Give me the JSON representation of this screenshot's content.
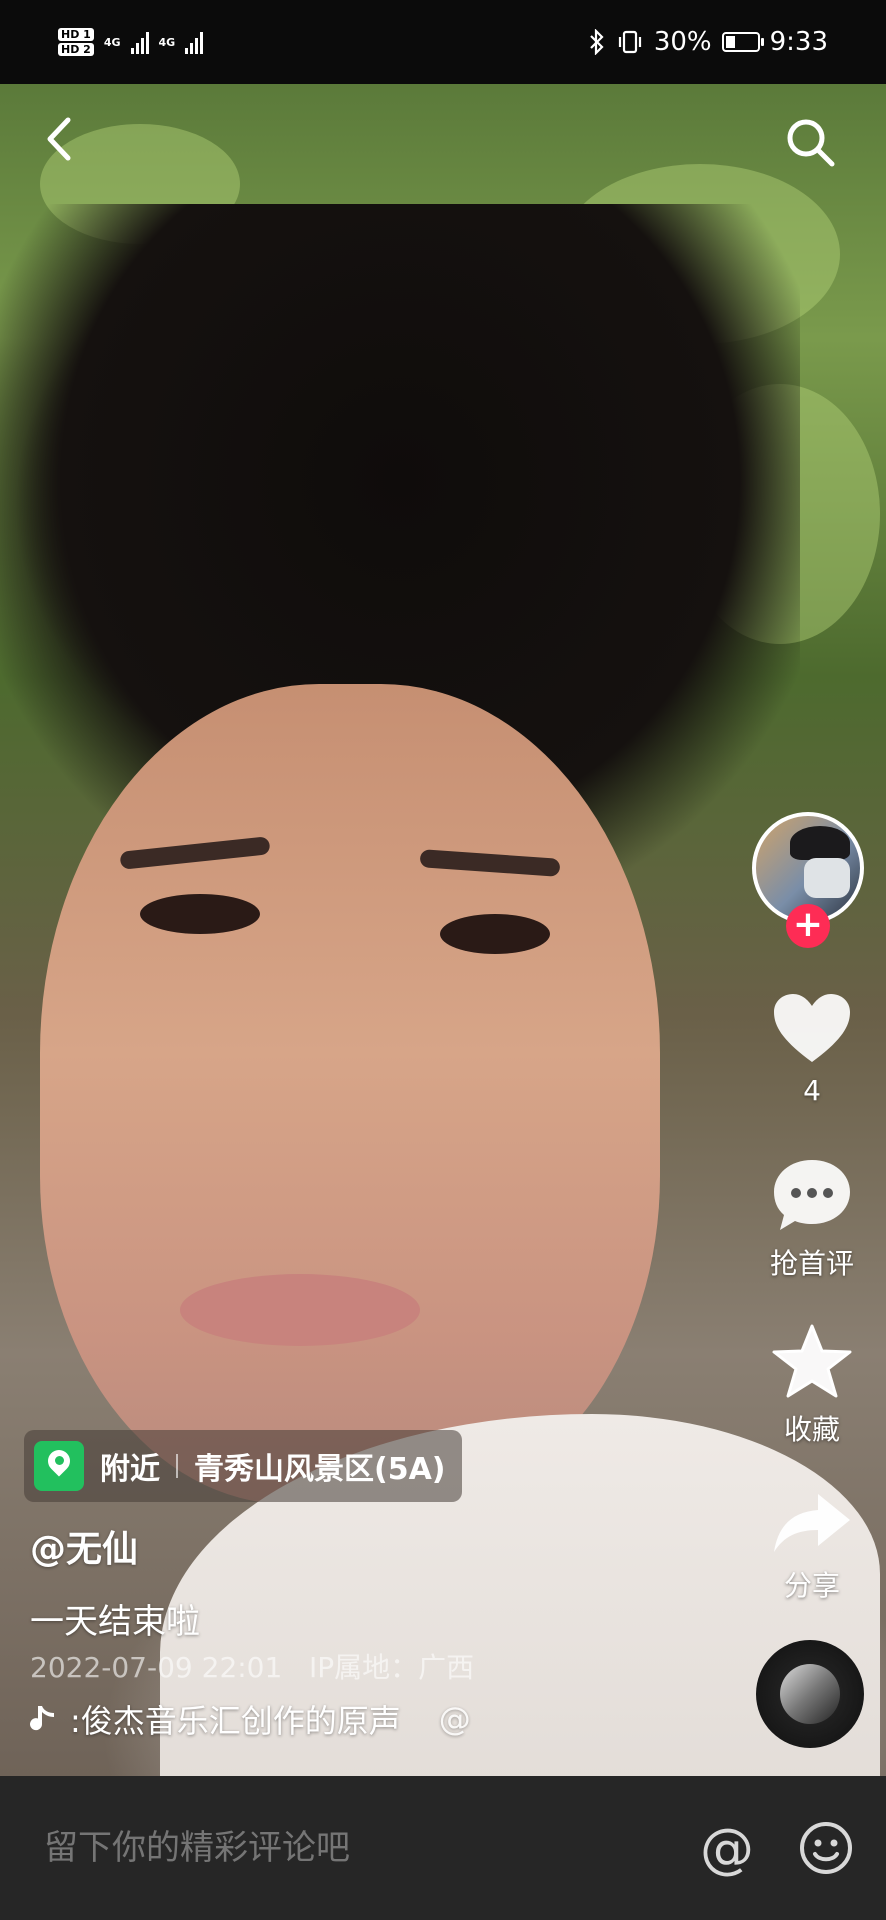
{
  "status_bar": {
    "network_hd1": "HD 1",
    "network_hd2": "HD 2",
    "network_type_1": "4G",
    "network_type_2": "4G",
    "battery_percent": "30%",
    "battery_level": 0.3,
    "time": "9:33"
  },
  "top_bar": {
    "back_icon": "chevron-left-icon",
    "search_icon": "search-icon"
  },
  "actions": {
    "like_count": "4",
    "comment_label": "抢首评",
    "favorite_label": "收藏",
    "share_label": "分享"
  },
  "location": {
    "prefix": "附近",
    "place": "青秀山风景区(5A)"
  },
  "post": {
    "username": "@无仙",
    "caption": "一天结束啦",
    "date": "2022-07-09 22:01",
    "ip_location": "IP属地：广西",
    "music": ":俊杰音乐汇创作的原声",
    "music_trailing": "@"
  },
  "comment_bar": {
    "placeholder": "留下你的精彩评论吧",
    "at_symbol": "@"
  },
  "colors": {
    "follow_accent": "#fe2c55",
    "location_icon": "#22c05e"
  }
}
